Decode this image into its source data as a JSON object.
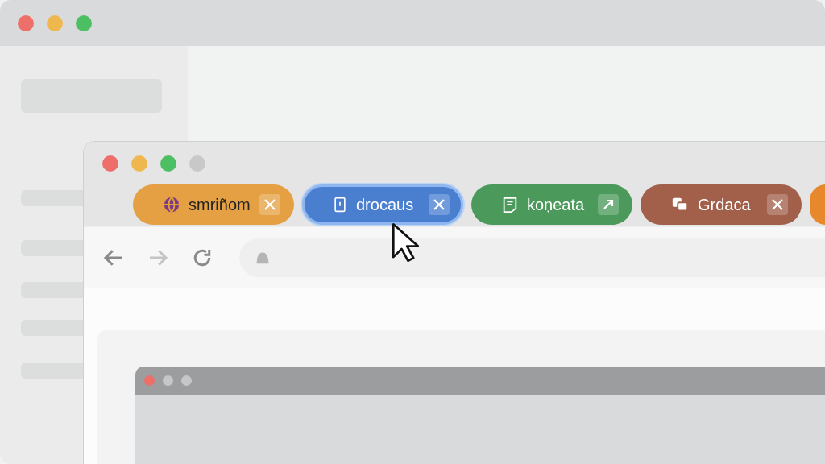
{
  "browser": {
    "tabs": [
      {
        "label": "smriñom",
        "color": "#e4a043",
        "selected": false,
        "kind": "close"
      },
      {
        "label": "drocaus",
        "color": "#4a7fd0",
        "selected": true,
        "kind": "close"
      },
      {
        "label": "koņeata",
        "color": "#4b9a5b",
        "selected": false,
        "kind": "arrow"
      },
      {
        "label": "Grdaca",
        "color": "#a2604b",
        "selected": false,
        "kind": "close"
      },
      {
        "color": "#e8882c",
        "selected": false,
        "kind": "partial"
      }
    ],
    "nav": [
      {
        "kind": "back",
        "disabled": false
      },
      {
        "kind": "forward",
        "disabled": true
      },
      {
        "kind": "reload",
        "disabled": false
      }
    ]
  }
}
